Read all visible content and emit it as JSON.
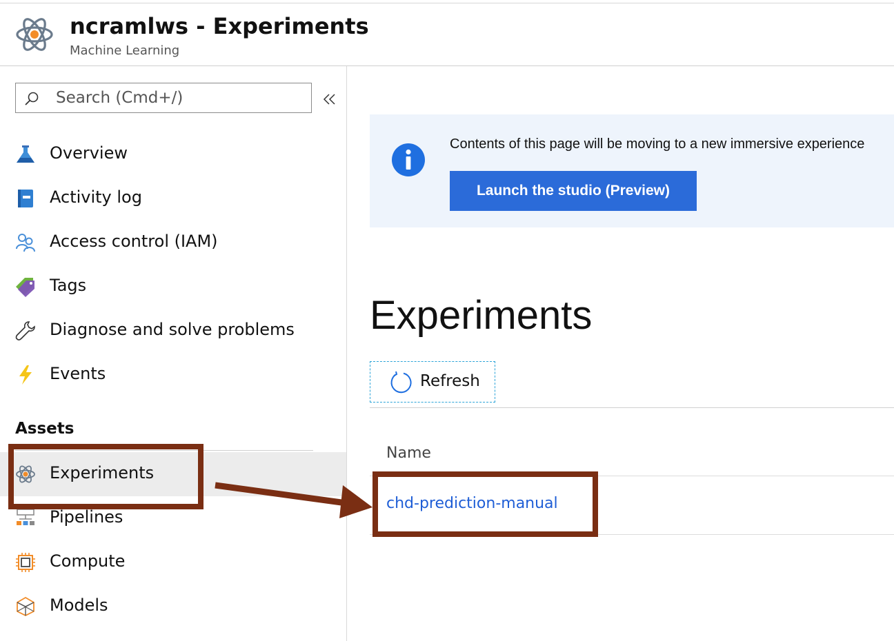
{
  "header": {
    "title": "ncramlws - Experiments",
    "subtitle": "Machine Learning"
  },
  "sidebar": {
    "search": {
      "placeholder": "Search (Cmd+/)",
      "value": ""
    },
    "items": [
      {
        "label": "Overview",
        "icon": "flask-icon"
      },
      {
        "label": "Activity log",
        "icon": "log-book-icon"
      },
      {
        "label": "Access control (IAM)",
        "icon": "people-icon"
      },
      {
        "label": "Tags",
        "icon": "tag-icon"
      },
      {
        "label": "Diagnose and solve problems",
        "icon": "wrench-icon"
      },
      {
        "label": "Events",
        "icon": "lightning-icon"
      }
    ],
    "assets_title": "Assets",
    "assets": [
      {
        "label": "Experiments",
        "icon": "atom-icon",
        "active": true
      },
      {
        "label": "Pipelines",
        "icon": "pipeline-icon"
      },
      {
        "label": "Compute",
        "icon": "chip-icon"
      },
      {
        "label": "Models",
        "icon": "model-icon"
      }
    ]
  },
  "banner": {
    "text": "Contents of this page will be moving to a new immersive experience",
    "button_label": "Launch the studio (Preview)"
  },
  "main": {
    "title": "Experiments",
    "refresh_label": "Refresh",
    "column_name": "Name",
    "rows": [
      {
        "name": "chd-prediction-manual"
      }
    ]
  },
  "colors": {
    "accent": "#2b6bd9",
    "link": "#1f5ed6",
    "callout": "#7a2e13",
    "banner_bg": "#eef4fc"
  }
}
